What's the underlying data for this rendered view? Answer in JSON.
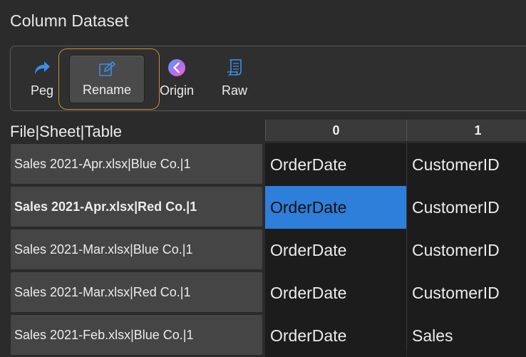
{
  "window": {
    "title": "Column Dataset"
  },
  "toolbar": {
    "peg": {
      "label": "Peg",
      "icon": "redo-arrow-icon",
      "color": "#3b8eea"
    },
    "rename": {
      "label": "Rename",
      "icon": "edit-pencil-icon",
      "color": "#3b8eea",
      "focus_ring": "#c98a3c"
    },
    "origin": {
      "label": "Origin",
      "icon": "chevron-left-circle-icon"
    },
    "raw": {
      "label": "Raw",
      "icon": "scroll-icon",
      "color": "#3b8eea"
    }
  },
  "grid": {
    "row_header_label": "File|Sheet|Table",
    "columns": [
      "0",
      "1"
    ],
    "rows": [
      {
        "label": "Sales 2021-Apr.xlsx|Blue Co.|1",
        "cells": [
          "OrderDate",
          "CustomerID"
        ],
        "bold": false
      },
      {
        "label": "Sales 2021-Apr.xlsx|Red Co.|1",
        "cells": [
          "OrderDate",
          "CustomerID"
        ],
        "bold": true
      },
      {
        "label": "Sales 2021-Mar.xlsx|Blue Co.|1",
        "cells": [
          "OrderDate",
          "CustomerID"
        ],
        "bold": false
      },
      {
        "label": "Sales 2021-Mar.xlsx|Red Co.|1",
        "cells": [
          "OrderDate",
          "CustomerID"
        ],
        "bold": false
      },
      {
        "label": "Sales 2021-Feb.xlsx|Blue Co.|1",
        "cells": [
          "OrderDate",
          "Sales"
        ],
        "bold": false
      }
    ],
    "selected_cell": {
      "row": 1,
      "col": 0
    },
    "selection_color": "#2e7fd9"
  }
}
